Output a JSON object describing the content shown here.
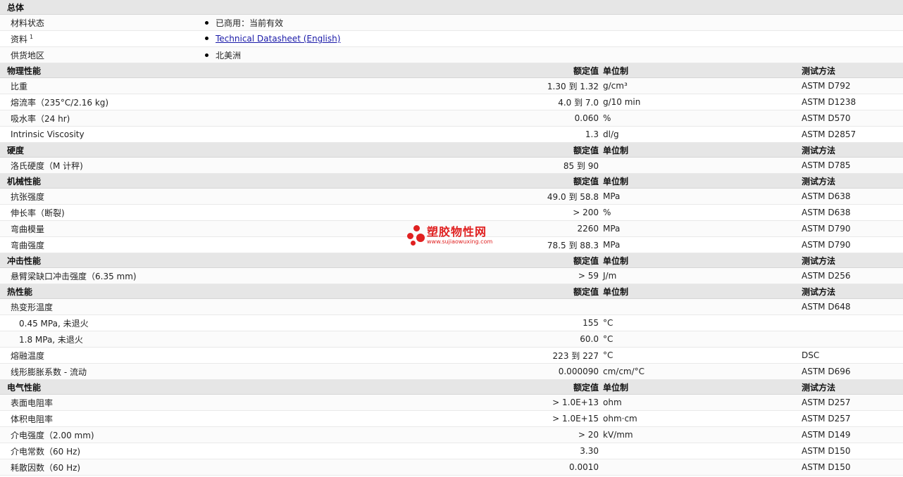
{
  "general": {
    "header": "总体",
    "rows": [
      {
        "label": "材料状态",
        "value": "已商用：当前有效"
      },
      {
        "label": "资料",
        "sup": "1",
        "value": "Technical Datasheet (English)",
        "is_link": true
      },
      {
        "label": "供货地区",
        "value": "北美洲"
      }
    ]
  },
  "columns": {
    "nominal": "额定值",
    "unit": "单位制",
    "method": "测试方法"
  },
  "sections": [
    {
      "title": "物理性能",
      "rows": [
        {
          "label": "比重",
          "nominal": "1.30 到  1.32",
          "unit": "g/cm³",
          "method": "ASTM D792"
        },
        {
          "label": "熔流率（235°C/2.16 kg)",
          "nominal": "4.0 到  7.0",
          "unit": "g/10 min",
          "method": "ASTM D1238"
        },
        {
          "label": "吸水率（24 hr)",
          "nominal": "0.060",
          "unit": "%",
          "method": "ASTM D570"
        },
        {
          "label": "Intrinsic Viscosity",
          "nominal": "1.3",
          "unit": "dl/g",
          "method": "ASTM D2857"
        }
      ]
    },
    {
      "title": "硬度",
      "rows": [
        {
          "label": "洛氏硬度（M 计秤)",
          "nominal": "85 到  90",
          "unit": "",
          "method": "ASTM D785"
        }
      ]
    },
    {
      "title": "机械性能",
      "rows": [
        {
          "label": "抗张强度",
          "nominal": "49.0 到  58.8",
          "unit": "MPa",
          "method": "ASTM D638"
        },
        {
          "label": "伸长率（断裂)",
          "nominal": "> 200",
          "unit": "%",
          "method": "ASTM D638"
        },
        {
          "label": "弯曲模量",
          "nominal": "2260",
          "unit": "MPa",
          "method": "ASTM D790"
        },
        {
          "label": "弯曲强度",
          "nominal": "78.5 到  88.3",
          "unit": "MPa",
          "method": "ASTM D790"
        }
      ]
    },
    {
      "title": "冲击性能",
      "rows": [
        {
          "label": "悬臂梁缺口冲击强度（6.35 mm)",
          "nominal": "> 59",
          "unit": "J/m",
          "method": "ASTM D256"
        }
      ]
    },
    {
      "title": "热性能",
      "rows": [
        {
          "label": "热变形温度",
          "nominal": "",
          "unit": "",
          "method": "ASTM D648"
        },
        {
          "label": "0.45 MPa, 未退火",
          "nominal": "155",
          "unit": "°C",
          "method": "",
          "sub": true
        },
        {
          "label": "1.8 MPa, 未退火",
          "nominal": "60.0",
          "unit": "°C",
          "method": "",
          "sub": true
        },
        {
          "label": "熔融温度",
          "nominal": "223 到  227",
          "unit": "°C",
          "method": "DSC"
        },
        {
          "label": "线形膨胀系数 - 流动",
          "nominal": "0.000090",
          "unit": "cm/cm/°C",
          "method": "ASTM D696"
        }
      ]
    },
    {
      "title": "电气性能",
      "rows": [
        {
          "label": "表面电阻率",
          "nominal": "> 1.0E+13",
          "unit": "ohm",
          "method": "ASTM D257"
        },
        {
          "label": "体积电阻率",
          "nominal": "> 1.0E+15",
          "unit": "ohm·cm",
          "method": "ASTM D257"
        },
        {
          "label": "介电强度（2.00 mm)",
          "nominal": "> 20",
          "unit": "kV/mm",
          "method": "ASTM D149"
        },
        {
          "label": "介电常数（60 Hz)",
          "nominal": "3.30",
          "unit": "",
          "method": "ASTM D150"
        },
        {
          "label": "耗散因数（60 Hz)",
          "nominal": "0.0010",
          "unit": "",
          "method": "ASTM D150"
        }
      ]
    }
  ],
  "watermark": {
    "name": "塑胶物性网",
    "url": "www.sujiaowuxing.com",
    "color": "#e02020"
  }
}
